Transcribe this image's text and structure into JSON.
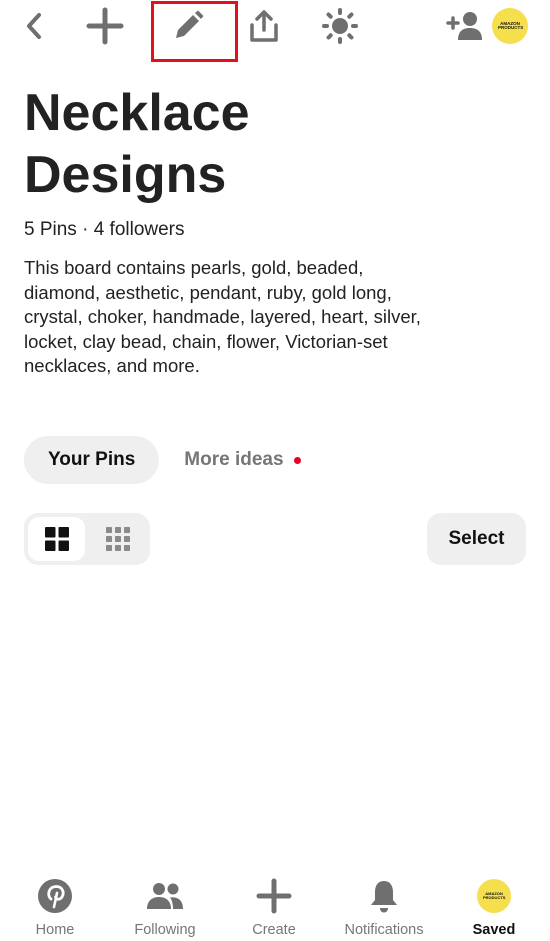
{
  "topbar": {
    "back_icon": "chevron-left-icon",
    "add_icon": "plus-icon",
    "edit_icon": "pencil-icon",
    "share_icon": "share-upload-icon",
    "organize_icon": "sparkle-sun-icon",
    "invite_icon": "add-person-icon",
    "profile_badge_text": "AMAZON PRODUCTS",
    "highlight_color": "#e3101f"
  },
  "board": {
    "title": "Necklace Designs",
    "meta": "5 Pins · 4 followers",
    "description": "This board contains pearls, gold, beaded, diamond, aesthetic, pendant, ruby, gold long, crystal, choker, handmade, layered, heart, silver, locket, clay bead, chain, flower, Victorian-set necklaces, and more."
  },
  "tabs": {
    "your_pins": "Your Pins",
    "more_ideas": "More ideas",
    "notification_dot_color": "#e60023"
  },
  "layout_toggle": {
    "options": [
      "large-grid-icon",
      "compact-grid-icon"
    ],
    "selected": "large-grid-icon"
  },
  "select_label": "Select",
  "bottom_nav": {
    "home": "Home",
    "following": "Following",
    "create": "Create",
    "notifications": "Notifications",
    "saved": "Saved",
    "active": "Saved",
    "avatar_text": "AMAZON PRODUCTS",
    "avatar_color": "#f5df4d"
  }
}
